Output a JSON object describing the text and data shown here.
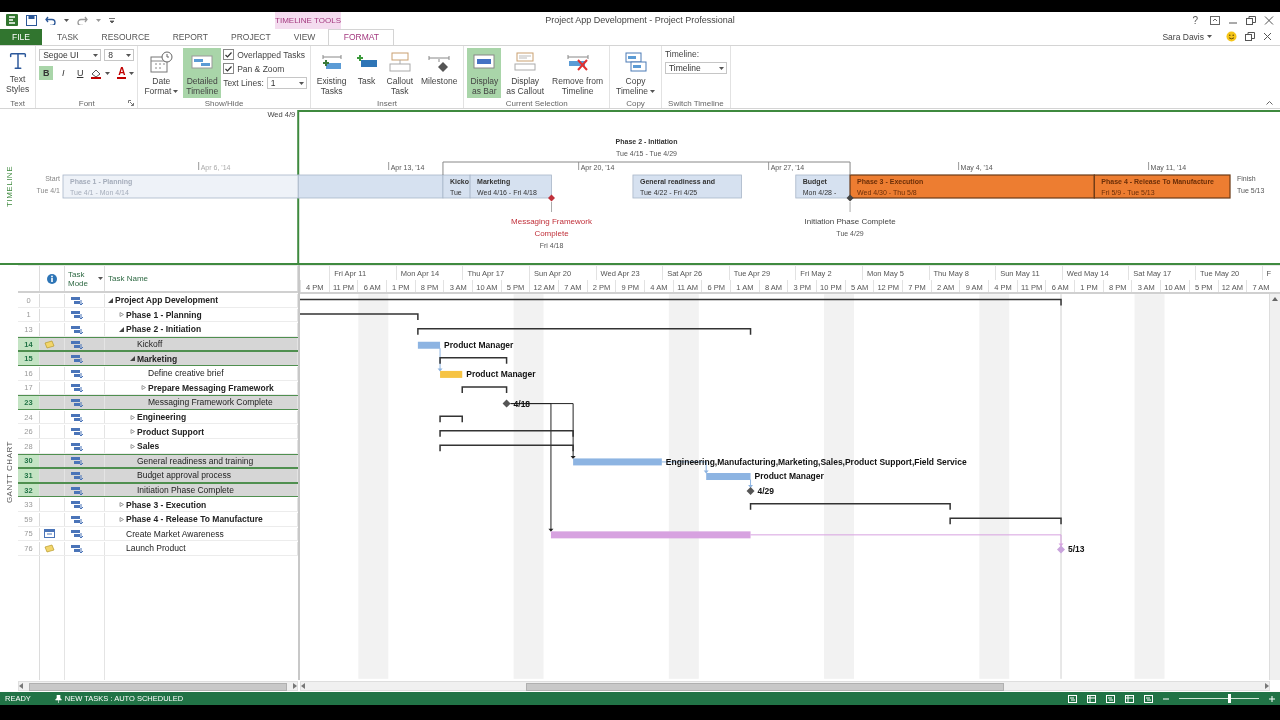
{
  "title_bar": {
    "title": "Project App Development - Project Professional",
    "context_group": "TIMELINE TOOLS",
    "help": "?"
  },
  "tabs": [
    {
      "label": "FILE",
      "kind": "file",
      "selected": false
    },
    {
      "label": "TASK",
      "kind": "tab",
      "selected": false
    },
    {
      "label": "RESOURCE",
      "kind": "tab",
      "selected": false
    },
    {
      "label": "REPORT",
      "kind": "tab",
      "selected": false
    },
    {
      "label": "PROJECT",
      "kind": "tab",
      "selected": false
    },
    {
      "label": "VIEW",
      "kind": "tab",
      "selected": false
    },
    {
      "label": "FORMAT",
      "kind": "context",
      "selected": true
    }
  ],
  "user": {
    "name": "Sara Davis"
  },
  "ribbon": [
    {
      "label": "Text",
      "items": [
        {
          "kind": "big",
          "lines": [
            "Text",
            "Styles"
          ],
          "selected": false
        }
      ]
    },
    {
      "label": "Font",
      "launcher": true,
      "items": [
        {
          "kind": "font",
          "font": "Segoe UI",
          "size": "8",
          "styles": [
            {
              "label": "B",
              "selected": true
            },
            {
              "label": "I",
              "selected": false
            },
            {
              "label": "U",
              "selected": false
            }
          ],
          "color_letter": "A"
        }
      ]
    },
    {
      "label": "Show/Hide",
      "items": [
        {
          "kind": "big",
          "lines": [
            "Date",
            "Format"
          ],
          "dropdown": true,
          "selected": false
        },
        {
          "kind": "big",
          "lines": [
            "Detailed",
            "Timeline"
          ],
          "selected": true
        },
        {
          "kind": "stack",
          "items": [
            {
              "kind": "checkbox",
              "label": "Overlapped Tasks",
              "checked": true
            },
            {
              "kind": "checkbox",
              "label": "Pan & Zoom",
              "checked": true
            },
            {
              "kind": "combo",
              "label": "Text Lines:",
              "value": "1"
            }
          ]
        }
      ]
    },
    {
      "label": "Insert",
      "items": [
        {
          "kind": "big",
          "lines": [
            "Existing",
            "Tasks"
          ],
          "selected": false
        },
        {
          "kind": "big",
          "lines": [
            "Task"
          ],
          "selected": false
        },
        {
          "kind": "big",
          "lines": [
            "Callout",
            "Task"
          ],
          "selected": false
        },
        {
          "kind": "big",
          "lines": [
            "Milestone"
          ],
          "selected": false
        }
      ]
    },
    {
      "label": "Current Selection",
      "items": [
        {
          "kind": "big",
          "lines": [
            "Display",
            "as Bar"
          ],
          "selected": true
        },
        {
          "kind": "big",
          "lines": [
            "Display",
            "as Callout"
          ],
          "selected": false
        },
        {
          "kind": "big",
          "lines": [
            "Remove from",
            "Timeline"
          ],
          "selected": false
        }
      ]
    },
    {
      "label": "Copy",
      "items": [
        {
          "kind": "big",
          "lines": [
            "Copy",
            "Timeline"
          ],
          "dropdown": true,
          "selected": false
        }
      ]
    },
    {
      "label": "Switch Timeline",
      "items": [
        {
          "kind": "switch",
          "label": "Timeline:",
          "value": "Timeline"
        }
      ]
    }
  ],
  "timeline": {
    "label": "TIMELINE",
    "range_label": "Wed 4/9",
    "start_label": "Start",
    "start_date": "Tue 4/1",
    "finish_label": "Finish",
    "finish_date": "Tue 5/13",
    "ticks": [
      "Apr 6, '14",
      "Apr 13, '14",
      "Apr 20, '14",
      "Apr 27, '14",
      "May 4, '14",
      "May 11, '14"
    ],
    "bars": [
      {
        "name": "Phase 1 - Planning",
        "dates": "Tue 4/1 - Mon 4/14",
        "color": "#d6e1f0"
      },
      {
        "name": "Kicko",
        "dates": "Tue",
        "color": "#d6e1f0"
      },
      {
        "name": "Marketing",
        "dates": "Wed 4/16 - Fri 4/18",
        "color": "#d6e1f0"
      },
      {
        "name": "General readiness and",
        "dates": "Tue 4/22 - Fri 4/25",
        "color": "#d6e1f0"
      },
      {
        "name": "Budget",
        "dates": "Mon 4/28 -",
        "color": "#d6e1f0"
      },
      {
        "name": "Phase 3 - Execution",
        "dates": "Wed 4/30 - Thu 5/8",
        "color": "#ed7d31"
      },
      {
        "name": "Phase 4 - Release To Manufacture",
        "dates": "Fri 5/9 - Tue 5/13",
        "color": "#ed7d31"
      }
    ],
    "callouts": [
      {
        "kind": "bracket",
        "lines": [
          "Phase 2 - Initiation"
        ],
        "dates": "Tue 4/15 - Tue 4/29",
        "color": "#333333"
      },
      {
        "kind": "milestone",
        "lines": [
          "Messaging Framework",
          "Complete"
        ],
        "dates": "Fri 4/18",
        "color": "#c0303a"
      },
      {
        "kind": "milestone",
        "lines": [
          "Initiation Phase Complete"
        ],
        "dates": "Tue 4/29",
        "color": "#444444"
      }
    ]
  },
  "gantt": {
    "label": "GANTT CHART",
    "columns": {
      "mode": "Task Mode",
      "name": "Task Name"
    },
    "timescale": {
      "major": [
        "Fri Apr 11",
        "Mon Apr 14",
        "Thu Apr 17",
        "Sun Apr 20",
        "Wed Apr 23",
        "Sat Apr 26",
        "Tue Apr 29",
        "Fri May 2",
        "Mon May 5",
        "Thu May 8",
        "Sun May 11",
        "Wed May 14",
        "Sat May 17",
        "Tue May 20",
        "F"
      ],
      "minor": [
        "4 PM",
        "11 PM",
        "6 AM",
        "1 PM",
        "8 PM",
        "3 AM",
        "10 AM",
        "5 PM",
        "12 AM",
        "7 AM",
        "2 PM",
        "9 PM",
        "4 AM",
        "11 AM",
        "6 PM",
        "1 AM",
        "8 AM",
        "3 PM",
        "10 PM",
        "5 AM",
        "12 PM",
        "7 PM",
        "2 AM",
        "9 AM",
        "4 PM",
        "11 PM",
        "6 AM",
        "1 PM",
        "8 PM",
        "3 AM",
        "10 AM",
        "5 PM",
        "12 AM",
        "7 AM"
      ]
    },
    "tasks": [
      {
        "id": "0",
        "name": "Project App Development",
        "kind": "summary",
        "expanded": true,
        "selected": false,
        "children": [
          {
            "id": "1",
            "name": "Phase 1 - Planning",
            "kind": "summary",
            "expanded": false,
            "selected": false
          },
          {
            "id": "13",
            "name": "Phase 2 - Initiation",
            "kind": "summary",
            "expanded": true,
            "selected": false,
            "children": [
              {
                "id": "14",
                "name": "Kickoff",
                "kind": "task",
                "selected": true,
                "indicator": {
                  "kind": "note"
                },
                "color": "#8db4e2",
                "bar_label": "Product Manager"
              },
              {
                "id": "15",
                "name": "Marketing",
                "kind": "summary",
                "expanded": true,
                "selected": true,
                "children": [
                  {
                    "id": "16",
                    "name": "Define creative brief",
                    "kind": "task",
                    "selected": false,
                    "color": "#f6c343",
                    "bar_label": "Product Manager"
                  },
                  {
                    "id": "17",
                    "name": "Prepare Messaging Framework",
                    "kind": "summary",
                    "expanded": false,
                    "selected": false
                  },
                  {
                    "id": "23",
                    "name": "Messaging Framework Complete",
                    "kind": "milestone",
                    "selected": true,
                    "color": "#555555",
                    "bar_label": "4/18"
                  }
                ]
              },
              {
                "id": "24",
                "name": "Engineering",
                "kind": "summary",
                "expanded": false,
                "selected": false
              },
              {
                "id": "26",
                "name": "Product Support",
                "kind": "summary",
                "expanded": false,
                "selected": false
              },
              {
                "id": "28",
                "name": "Sales",
                "kind": "summary",
                "expanded": false,
                "selected": false
              },
              {
                "id": "30",
                "name": "General readiness and training",
                "kind": "task",
                "selected": true,
                "color": "#8db4e2",
                "bar_label": "Engineering,Manufacturing,Marketing,Sales,Product Support,Field Service"
              },
              {
                "id": "31",
                "name": "Budget approval process",
                "kind": "task",
                "selected": true,
                "color": "#8db4e2",
                "bar_label": "Product Manager"
              },
              {
                "id": "32",
                "name": "Initiation Phase Complete",
                "kind": "milestone",
                "selected": true,
                "color": "#555555",
                "bar_label": "4/29"
              }
            ]
          },
          {
            "id": "33",
            "name": "Phase 3 - Execution",
            "kind": "summary",
            "expanded": false,
            "selected": false
          },
          {
            "id": "59",
            "name": "Phase 4 - Release To Manufacture",
            "kind": "summary",
            "expanded": false,
            "selected": false
          },
          {
            "id": "75",
            "name": "Create Market Awareness",
            "kind": "task",
            "selected": false,
            "indicator": {
              "kind": "calendar"
            },
            "color": "#d7a2e0"
          },
          {
            "id": "76",
            "name": "Launch Product",
            "kind": "milestone",
            "selected": false,
            "indicator": {
              "kind": "note"
            },
            "color": "#c9a3dc",
            "bar_label": "5/13"
          }
        ]
      }
    ]
  },
  "status_bar": {
    "mode": "READY",
    "new_tasks": "NEW TASKS : AUTO SCHEDULED",
    "zoom": {
      "level": 0.62
    }
  }
}
